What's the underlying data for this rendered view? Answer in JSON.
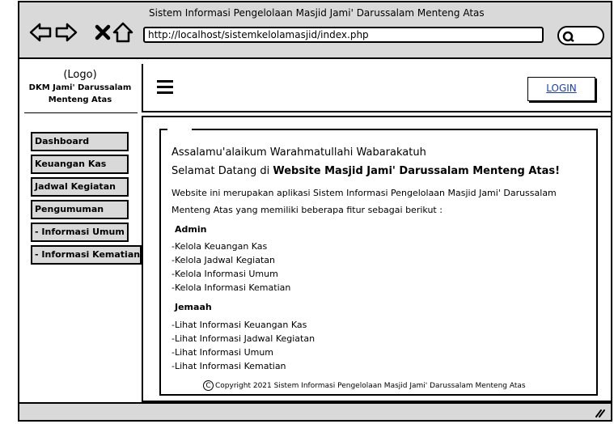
{
  "window": {
    "title": "Sistem Informasi Pengelolaan Masjid Jami' Darussalam Menteng Atas",
    "url": "http://localhost/sistemkelolamasjid/index.php"
  },
  "icons": {
    "back": "back-arrow-icon",
    "forward": "forward-arrow-icon",
    "close": "close-x-icon",
    "home": "home-icon",
    "search": "search-icon",
    "menu": "hamburger-icon",
    "resize": "resize-grip-icon",
    "copyright": "copyright-icon"
  },
  "sidebar": {
    "logo": "(Logo)",
    "org_line1": "DKM Jami' Darussalam",
    "org_line2": "Menteng Atas",
    "items": [
      {
        "label": "Dashboard"
      },
      {
        "label": "Keuangan Kas"
      },
      {
        "label": "Jadwal Kegiatan"
      },
      {
        "label": "Pengumuman"
      },
      {
        "label": "- Informasi Umum"
      },
      {
        "label": "- Informasi Kematian"
      }
    ]
  },
  "header": {
    "login_label": "LOGIN"
  },
  "main": {
    "greeting": "Assalamu'alaikum Warahmatullahi Wabarakatuh",
    "welcome_prefix": "Selamat Datang di ",
    "welcome_bold": "Website Masjid Jami' Darussalam Menteng Atas!",
    "desc_line1": "Website ini merupakan aplikasi Sistem Informasi Pengelolaan Masjid Jami' Darussalam",
    "desc_line2": "Menteng Atas yang memiliki beberapa fitur sebagai berikut :",
    "admin_heading": "Admin",
    "admin_features": [
      "-Kelola Keuangan Kas",
      "-Kelola Jadwal Kegiatan",
      "-Kelola Informasi Umum",
      "-Kelola Informasi Kematian"
    ],
    "jemaah_heading": "Jemaah",
    "jemaah_features": [
      "-Lihat Informasi Keuangan Kas",
      "-Lihat Informasi Jadwal Kegiatan",
      "-Lihat Informasi Umum",
      "-Lihat Informasi Kematian"
    ],
    "copyright_symbol": "C",
    "copyright": "Copyright 2021 Sistem Informasi Pengelolaan Masjid Jami' Darussalam Menteng Atas"
  }
}
